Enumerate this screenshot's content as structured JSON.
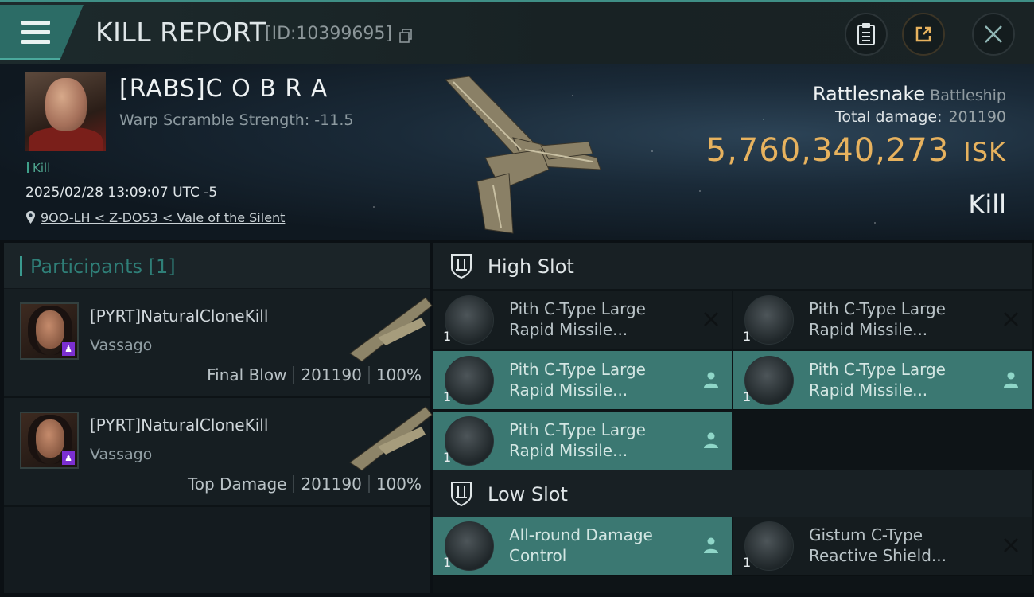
{
  "header": {
    "title": "KILL REPORT",
    "report_id": "[ID:10399695]"
  },
  "victim": {
    "name": "[RABS]C O B R A",
    "warp_scramble": "Warp Scramble Strength: -11.5",
    "kill_tag": "Kill",
    "datetime": "2025/02/28 13:09:07 UTC -5",
    "location": "9OO-LH < Z-DO53 < Vale of the Silent"
  },
  "ship": {
    "name": "Rattlesnake",
    "class": "Battleship",
    "total_damage_label": "Total damage:",
    "total_damage": "201190",
    "isk_value": "5,760,340,273",
    "isk_unit": "ISK",
    "result": "Kill"
  },
  "participants": {
    "header_label": "Participants",
    "count": "[1]",
    "rows": [
      {
        "name": "[PYRT]NaturalCloneKill",
        "corp": "Vassago",
        "role": "Final Blow",
        "damage": "201190",
        "percent": "100%"
      },
      {
        "name": "[PYRT]NaturalCloneKill",
        "corp": "Vassago",
        "role": "Top Damage",
        "damage": "201190",
        "percent": "100%"
      }
    ]
  },
  "slots": {
    "high_label": "High Slot",
    "low_label": "Low Slot",
    "high_items": [
      {
        "name": "Pith C-Type Large Rapid Missile...",
        "qty": "1",
        "status": "destroyed"
      },
      {
        "name": "Pith C-Type Large Rapid Missile...",
        "qty": "1",
        "status": "destroyed"
      },
      {
        "name": "Pith C-Type Large Rapid Missile...",
        "qty": "1",
        "status": "dropped"
      },
      {
        "name": "Pith C-Type Large Rapid Missile...",
        "qty": "1",
        "status": "dropped"
      },
      {
        "name": "Pith C-Type Large Rapid Missile...",
        "qty": "1",
        "status": "dropped"
      }
    ],
    "low_items": [
      {
        "name": "All-round Damage Control",
        "qty": "1",
        "status": "dropped"
      },
      {
        "name": "Gistum C-Type Reactive Shield...",
        "qty": "1",
        "status": "destroyed"
      }
    ]
  },
  "colors": {
    "accent_teal": "#3b7872",
    "isk_gold": "#e7b25e",
    "header_teal": "#2c6c66"
  }
}
